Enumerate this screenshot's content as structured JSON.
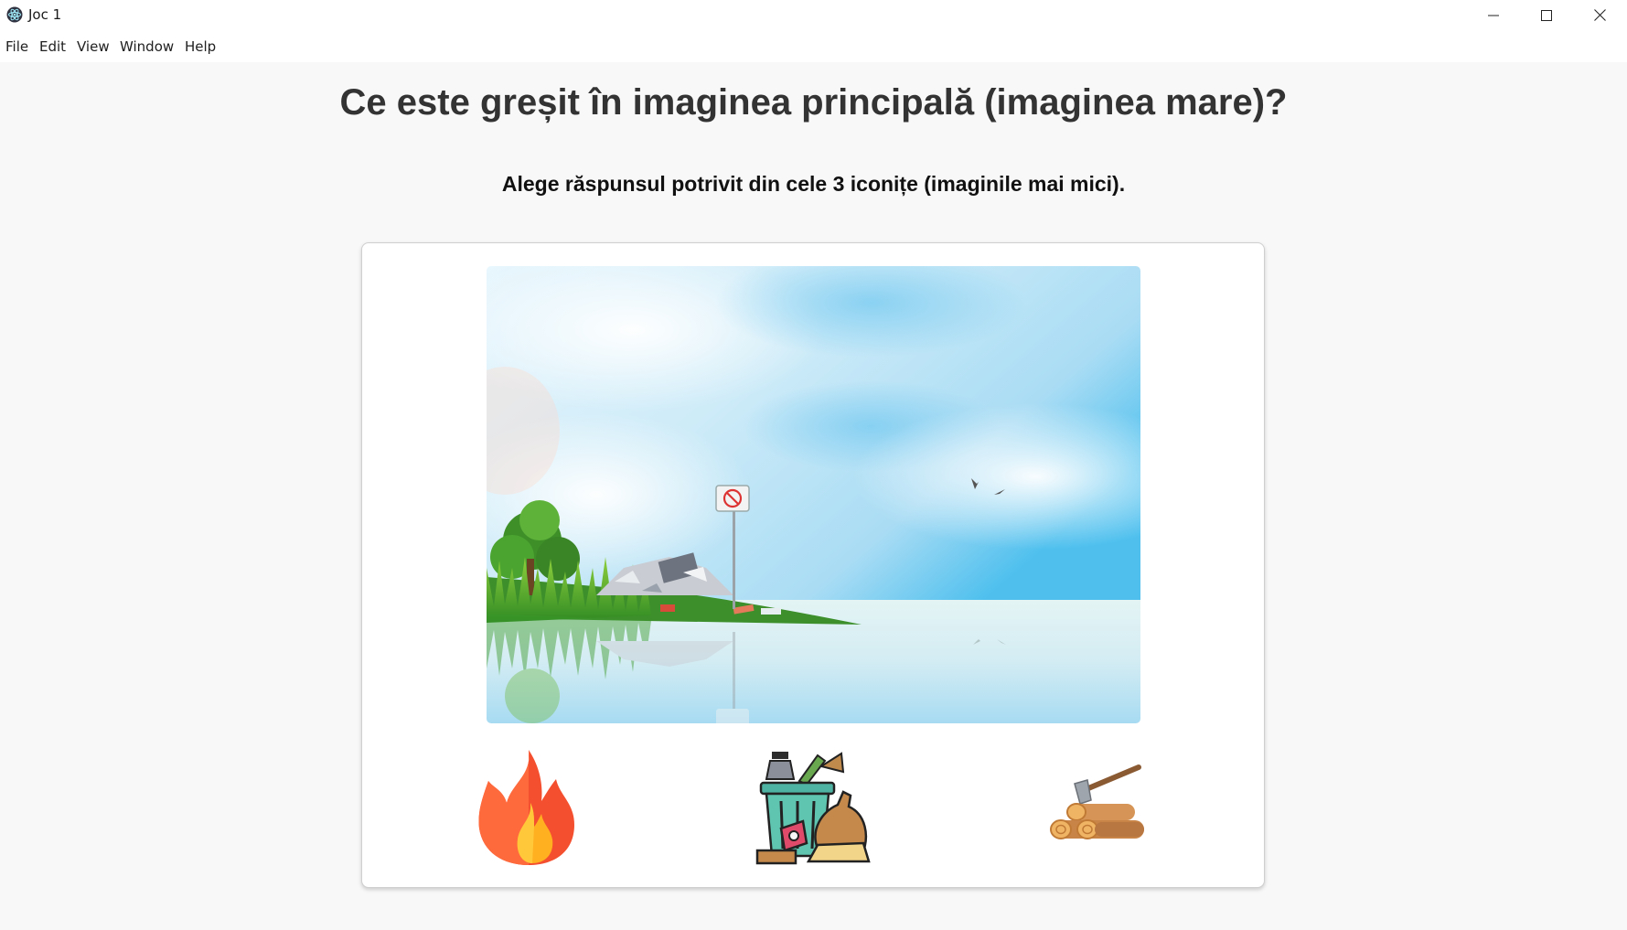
{
  "window": {
    "title": "Joc 1",
    "app_icon": "electron-icon",
    "controls": [
      "minimize-icon",
      "maximize-icon",
      "close-icon"
    ]
  },
  "menu": {
    "items": [
      {
        "label": "File"
      },
      {
        "label": "Edit"
      },
      {
        "label": "View"
      },
      {
        "label": "Window"
      },
      {
        "label": "Help"
      }
    ]
  },
  "game": {
    "question": "Ce este greșit în imaginea principală (imaginea mare)?",
    "instruction": "Alege răspunsul potrivit din cele 3 iconițe (imaginile mai mici).",
    "main_image": "lake-shore-with-trash-scene",
    "choices": [
      {
        "icon": "fire-icon"
      },
      {
        "icon": "trash-bin-icon"
      },
      {
        "icon": "firewood-axe-icon"
      }
    ]
  },
  "colors": {
    "background": "#f8f8f8",
    "card_border": "#cfcfcf",
    "heading": "#333333",
    "text": "#111111"
  }
}
